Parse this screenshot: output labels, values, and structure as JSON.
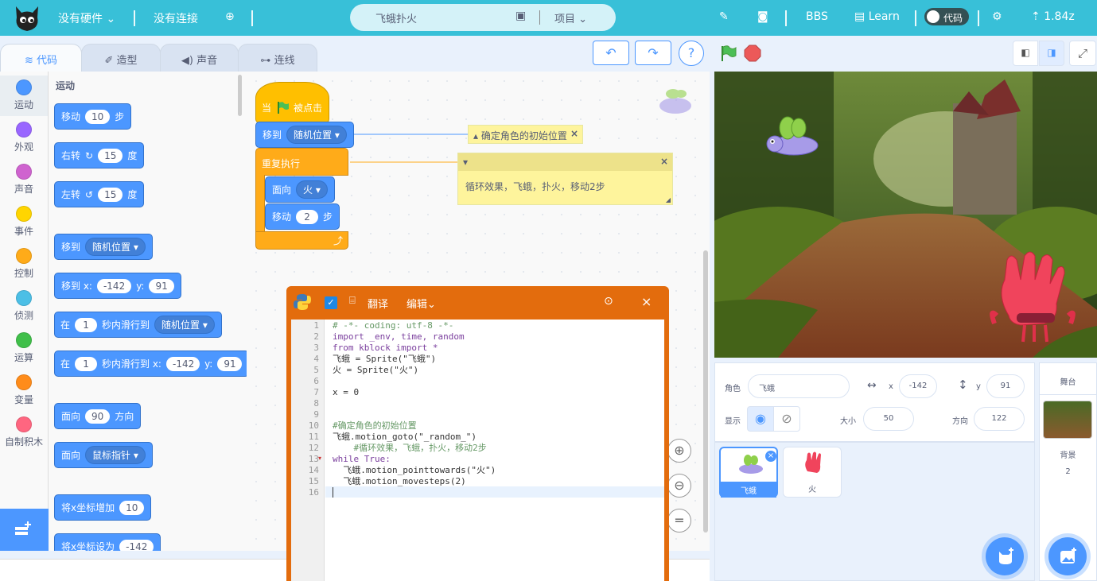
{
  "topbar": {
    "hardware": "没有硬件",
    "connection": "没有连接",
    "project_name": "飞蛾扑火",
    "project_menu": "项目",
    "bbs": "BBS",
    "learn": "Learn",
    "code_toggle": "代码",
    "version": "1.84z"
  },
  "tabs": {
    "code": "代码",
    "costume": "造型",
    "sound": "声音",
    "wiring": "连线"
  },
  "categories": [
    {
      "label": "运动",
      "color": "#4c97ff"
    },
    {
      "label": "外观",
      "color": "#9966ff"
    },
    {
      "label": "声音",
      "color": "#cf63cf"
    },
    {
      "label": "事件",
      "color": "#ffd500"
    },
    {
      "label": "控制",
      "color": "#ffab19"
    },
    {
      "label": "侦测",
      "color": "#4cbfe6"
    },
    {
      "label": "运算",
      "color": "#40bf4a"
    },
    {
      "label": "变量",
      "color": "#ff8c1a"
    },
    {
      "label": "自制积木",
      "color": "#ff6680"
    }
  ],
  "palette": {
    "heading": "运动",
    "move": {
      "a": "移动",
      "v": "10",
      "b": "步"
    },
    "turn_right": {
      "a": "右转",
      "v": "15",
      "b": "度"
    },
    "turn_left": {
      "a": "左转",
      "v": "15",
      "b": "度"
    },
    "goto": {
      "a": "移到",
      "dd": "随机位置"
    },
    "goto_xy": {
      "a": "移到 x:",
      "x": "-142",
      "y_label": "y:",
      "y": "91"
    },
    "glide_to": {
      "a": "在",
      "v": "1",
      "b": "秒内滑行到",
      "dd": "随机位置"
    },
    "glide_xy": {
      "a": "在",
      "v": "1",
      "b": "秒内滑行到 x:",
      "x": "-142",
      "y_label": "y:",
      "y": "91"
    },
    "point_dir": {
      "a": "面向",
      "v": "90",
      "b": "方向"
    },
    "point_towards": {
      "a": "面向",
      "dd": "鼠标指针"
    },
    "change_x": {
      "a": "将x坐标增加",
      "v": "10"
    },
    "set_x": {
      "a": "将x坐标设为",
      "v": "-142"
    }
  },
  "script": {
    "hat_when": "当",
    "hat_clicked": "被点击",
    "goto": "移到",
    "goto_dd": "随机位置",
    "forever": "重复执行",
    "point": "面向",
    "point_dd": "火",
    "move": "移动",
    "move_v": "2",
    "move_b": "步"
  },
  "comments": {
    "c1": "确定角色的初始位置",
    "c2": "循环效果，飞蛾，扑火，移动2步"
  },
  "python": {
    "translate": "翻译",
    "edit": "编辑",
    "line_numbers": [
      "1",
      "2",
      "3",
      "4",
      "5",
      "6",
      "7",
      "8",
      "9",
      "10",
      "11",
      "12",
      "13",
      "14",
      "15",
      "16"
    ],
    "lines": [
      "# -*- coding: utf-8 -*-",
      "import _env, time, random",
      "from kblock import *",
      "飞蛾 = Sprite(\"飞蛾\")",
      "火 = Sprite(\"火\")",
      "",
      "x = 0",
      "",
      "",
      "#确定角色的初始位置",
      "飞蛾.motion_goto(\"_random_\")",
      "    #循环效果，飞蛾，扑火，移动2步",
      "while True:",
      "  飞蛾.motion_pointtowards(\"火\")",
      "  飞蛾.motion_movesteps(2)",
      ""
    ]
  },
  "sprite_info": {
    "sprite_label": "角色",
    "sprite_name": "飞蛾",
    "x_label": "x",
    "x": "-142",
    "y_label": "y",
    "y": "91",
    "show_label": "显示",
    "size_label": "大小",
    "size": "50",
    "dir_label": "方向",
    "dir": "122"
  },
  "sprites": [
    {
      "name": "飞蛾"
    },
    {
      "name": "火"
    }
  ],
  "stage_panel": {
    "title": "舞台",
    "backdrop_label": "背景",
    "backdrop_count": "2"
  }
}
